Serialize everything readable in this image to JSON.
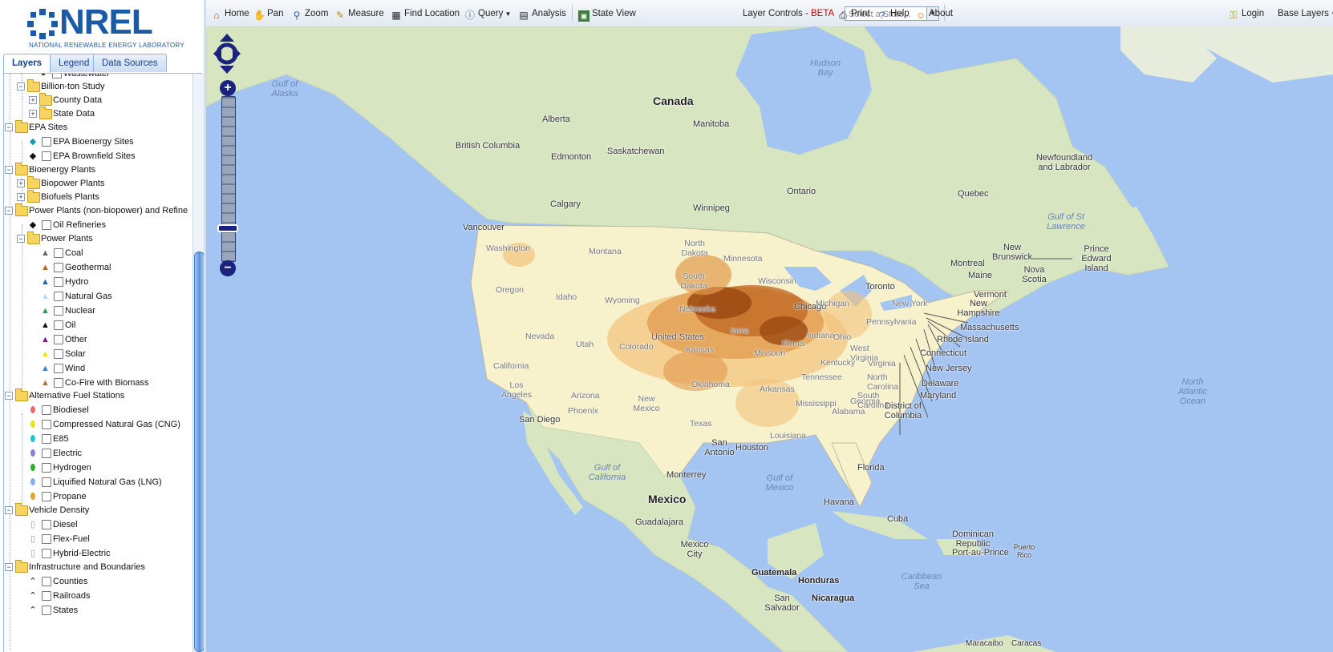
{
  "brand": {
    "name": "NREL",
    "subtitle": "NATIONAL RENEWABLE ENERGY LABORATORY",
    "color": "#1b5aa6"
  },
  "tabs": [
    {
      "label": "Layers",
      "active": true
    },
    {
      "label": "Legend",
      "active": false
    },
    {
      "label": "Data Sources",
      "active": false
    }
  ],
  "tree": {
    "wastewater": "Wastewater",
    "billion_ton": "Billion-ton Study",
    "county_data": "County Data",
    "state_data": "State Data",
    "epa_sites": "EPA Sites",
    "epa_bioenergy": "EPA Bioenergy Sites",
    "epa_brownfield": "EPA Brownfield Sites",
    "bioenergy_plants": "Bioenergy Plants",
    "biopower_plants": "Biopower Plants",
    "biofuels_plants": "Biofuels Plants",
    "power_plants_group": "Power Plants (non-biopower) and Refine",
    "oil_refineries": "Oil Refineries",
    "power_plants": "Power Plants",
    "pp_items": [
      "Coal",
      "Geothermal",
      "Hydro",
      "Natural Gas",
      "Nuclear",
      "Oil",
      "Other",
      "Solar",
      "Wind",
      "Co-Fire with Biomass"
    ],
    "pp_colors": [
      "#666666",
      "#b5651d",
      "#1f5fbf",
      "#b8d8f0",
      "#2e9e57",
      "#111111",
      "#7a1e8c",
      "#f2e21a",
      "#3b7de0",
      "#b5733a"
    ],
    "alt_fuel": "Alternative Fuel Stations",
    "af_items": [
      "Biodiesel",
      "Compressed Natural Gas (CNG)",
      "E85",
      "Electric",
      "Hydrogen",
      "Liquified Natural Gas (LNG)",
      "Propane"
    ],
    "af_colors": [
      "#e86a6a",
      "#e2e21a",
      "#19c6d6",
      "#8d7fd6",
      "#28b428",
      "#7fb2e8",
      "#e8a31e"
    ],
    "vehicle_density": "Vehicle Density",
    "vd_items": [
      "Diesel",
      "Flex-Fuel",
      "Hybrid-Electric"
    ],
    "infrastructure": "Infrastructure and Boundaries",
    "ib_items": [
      "Counties",
      "Railroads",
      "States"
    ]
  },
  "toolbar": {
    "home": "Home",
    "pan": "Pan",
    "zoom": "Zoom",
    "measure": "Measure",
    "find_location": "Find Location",
    "query": "Query",
    "analysis": "Analysis",
    "state_view": "State View",
    "state_placeholder": "Select a State...",
    "layer_controls": "Layer Controls -",
    "beta": "BETA",
    "print": "Print",
    "help": "Help",
    "about": "About",
    "login": "Login",
    "base_layers": "Base Layers"
  },
  "map_labels": {
    "countries": [
      "Canada",
      "Mexico"
    ],
    "provinces": [
      "Alberta",
      "Manitoba",
      "British Columbia",
      "Saskatchewan",
      "Ontario",
      "Quebec",
      "Newfoundland and Labrador",
      "New Brunswick",
      "Nova Scotia",
      "Prince Edward Island"
    ],
    "cities": [
      "Edmonton",
      "Calgary",
      "Winnipeg",
      "Vancouver",
      "Montreal",
      "Toronto",
      "San Diego",
      "Monterrey",
      "Guadalajara",
      "Mexico City",
      "Havana",
      "Guatemala",
      "Honduras",
      "Nicaragua",
      "San Salvador",
      "Port-au-Prince",
      "Houston",
      "San Antonio",
      "Chicago"
    ],
    "states": [
      "Washington",
      "Oregon",
      "Idaho",
      "Montana",
      "Wyoming",
      "Nevada",
      "Utah",
      "Colorado",
      "California",
      "Arizona",
      "New Mexico",
      "Los Angeles",
      "Phoenix",
      "Texas",
      "Kansas",
      "Oklahoma",
      "Missouri",
      "Arkansas",
      "Louisiana",
      "Mississippi",
      "Alabama",
      "Georgia",
      "Florida",
      "Tennessee",
      "Kentucky",
      "West Virginia",
      "North Carolina",
      "South Carolina",
      "Iowa",
      "Illinois",
      "Indiana",
      "Ohio",
      "Pennsylvania",
      "New York",
      "Minnesota",
      "Wisconsin",
      "North Dakota",
      "South Dakota",
      "Nebraska",
      "Michigan",
      "Virginia"
    ],
    "callouts": [
      "Maine",
      "Vermont",
      "New Hampshire",
      "Massachusetts",
      "Rhode Island",
      "Connecticut",
      "New Jersey",
      "Delaware",
      "Maryland",
      "District of Columbia",
      "Cuba",
      "Dominican Republic",
      "Puerto Rico",
      "United States"
    ],
    "water": [
      "Hudson Bay",
      "Gulf of Alaska",
      "Gulf of St Lawrence",
      "North Atlantic Ocean",
      "Gulf of California",
      "Gulf of Mexico",
      "Caribbean Sea"
    ],
    "extra": [
      "Maracaibo",
      "Caracas"
    ]
  },
  "colors": {
    "ocean": "#a4c4f2",
    "land": "#d9e6c3",
    "us_land": "#f6f1c9",
    "heat_dark": "#9c4a12",
    "heat_mid": "#d7823a",
    "heat_light": "#f2c27a",
    "zoom_control": "#1a237e"
  }
}
